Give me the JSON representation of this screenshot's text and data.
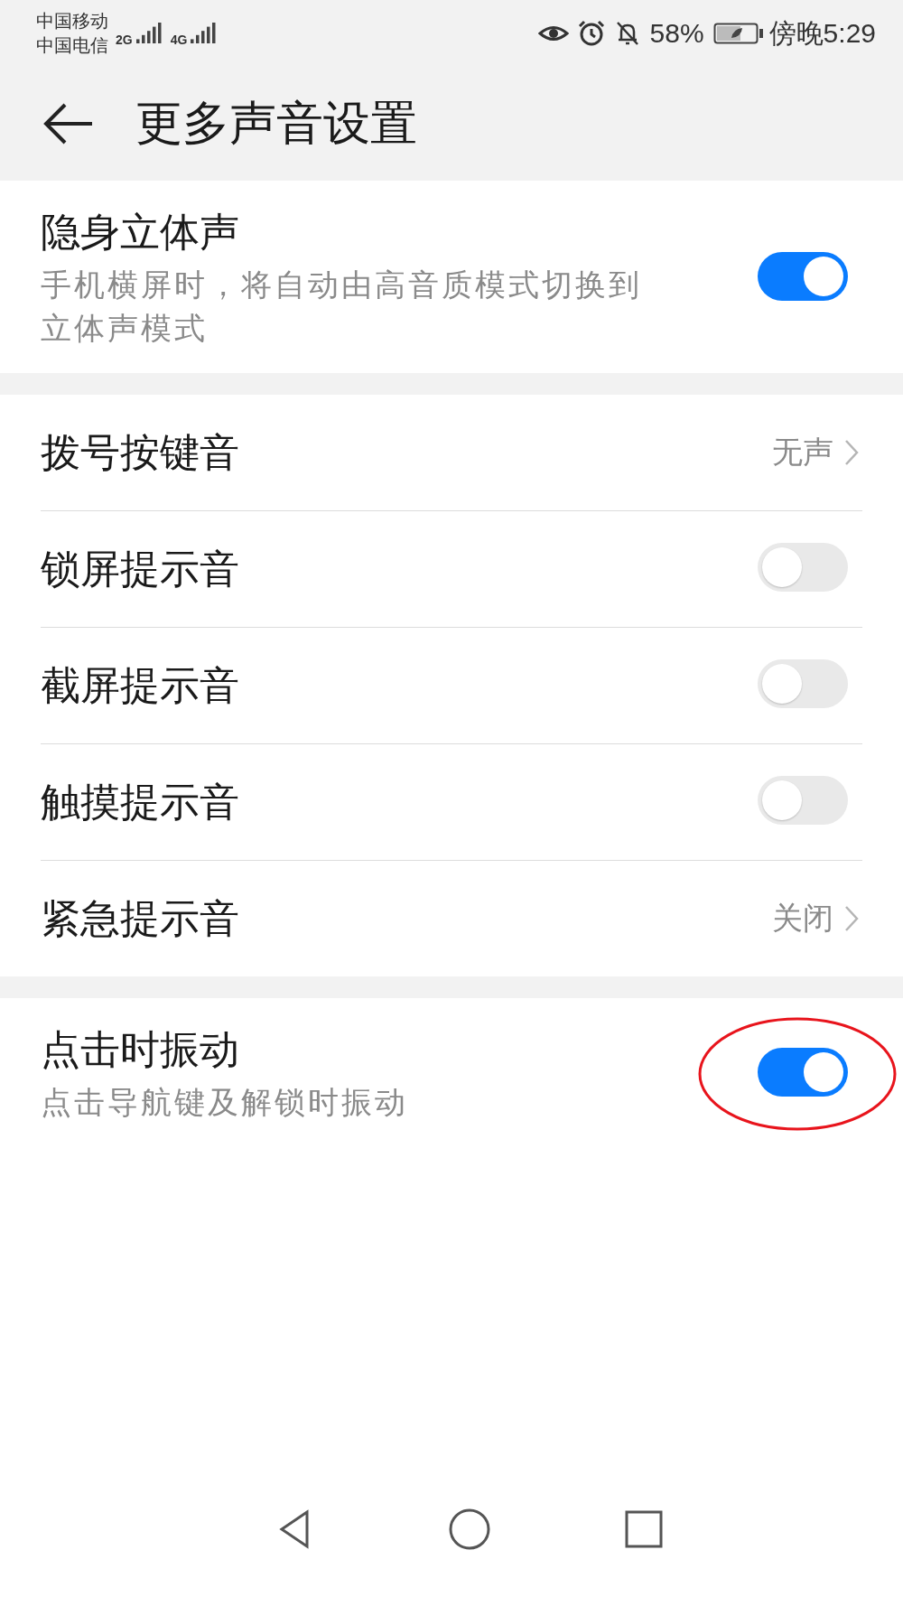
{
  "status_bar": {
    "carriers": [
      "中国移动",
      "中国电信"
    ],
    "networks": [
      "2G",
      "4G"
    ],
    "battery": "58%",
    "time": "傍晚5:29"
  },
  "header": {
    "title": "更多声音设置"
  },
  "sections": [
    {
      "items": [
        {
          "kind": "toggle",
          "title": "隐身立体声",
          "subtitle": "手机横屏时，将自动由高音质模式切换到立体声模式",
          "on": true,
          "circled": false
        }
      ]
    },
    {
      "items": [
        {
          "kind": "link",
          "title": "拨号按键音",
          "value": "无声"
        },
        {
          "kind": "toggle",
          "title": "锁屏提示音",
          "on": false,
          "circled": false
        },
        {
          "kind": "toggle",
          "title": "截屏提示音",
          "on": false,
          "circled": false
        },
        {
          "kind": "toggle",
          "title": "触摸提示音",
          "on": false,
          "circled": false
        },
        {
          "kind": "link",
          "title": "紧急提示音",
          "value": "关闭"
        }
      ]
    },
    {
      "items": [
        {
          "kind": "toggle",
          "title": "点击时振动",
          "subtitle": "点击导航键及解锁时振动",
          "on": true,
          "circled": true
        }
      ]
    }
  ]
}
